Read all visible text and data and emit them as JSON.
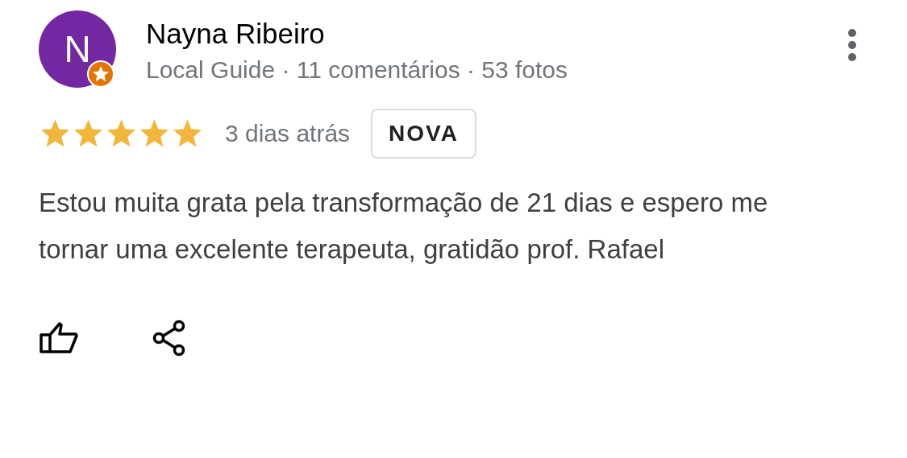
{
  "review": {
    "avatar_letter": "N",
    "author": "Nayna Ribeiro",
    "meta": "Local Guide · 11 comentários · 53 fotos",
    "local_guide": true,
    "stars": 5,
    "date": "3 dias atrás",
    "badge": "NOVA",
    "text": "Estou muita grata pela transformação de 21 dias e espero me tornar uma excelente terapeuta, gratidão prof. Rafael"
  }
}
